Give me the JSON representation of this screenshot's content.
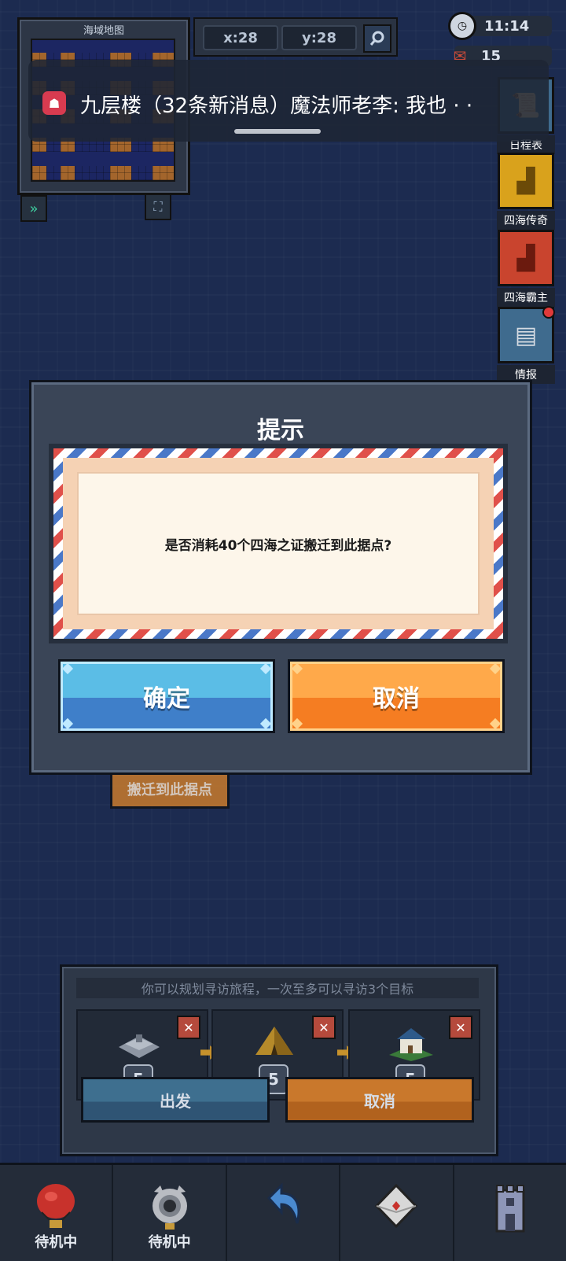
{
  "minimap": {
    "title": "海域地图"
  },
  "coords": {
    "x": "x:28",
    "y": "y:28"
  },
  "status": {
    "time": "11:14",
    "count": "15"
  },
  "notification": {
    "text": "九层楼（32条新消息）魔法师老李: 我也 · ·"
  },
  "side_menu": [
    {
      "label": "日程表",
      "color": "#3f6b8e",
      "icon": "scroll-icon"
    },
    {
      "label": "四海传奇",
      "color": "#d9a21c",
      "icon": "legend-icon"
    },
    {
      "label": "四海霸主",
      "color": "#c9442e",
      "icon": "overlord-icon"
    },
    {
      "label": "情报",
      "color": "#3f6b8e",
      "icon": "intel-icon"
    }
  ],
  "dialog": {
    "title": "提示",
    "message": "是否消耗40个四海之证搬迁到此据点?",
    "ok_label": "确定",
    "cancel_label": "取消"
  },
  "map_button": {
    "label": "搬迁到此据点"
  },
  "plan_panel": {
    "hint": "你可以规划寻访旅程，一次至多可以寻访3个目标",
    "slots": [
      {
        "level": "5",
        "icon": "ruins-icon"
      },
      {
        "level": "5",
        "icon": "tent-icon"
      },
      {
        "level": "5",
        "icon": "house-icon"
      }
    ],
    "depart_label": "出发",
    "cancel_label": "取消"
  },
  "bottom_nav": [
    {
      "label": "待机中",
      "icon": "balloon-icon"
    },
    {
      "label": "待机中",
      "icon": "cannon-icon"
    },
    {
      "label": "",
      "icon": "return-icon"
    },
    {
      "label": "",
      "icon": "mail-icon"
    },
    {
      "label": "",
      "icon": "tower-icon"
    }
  ]
}
